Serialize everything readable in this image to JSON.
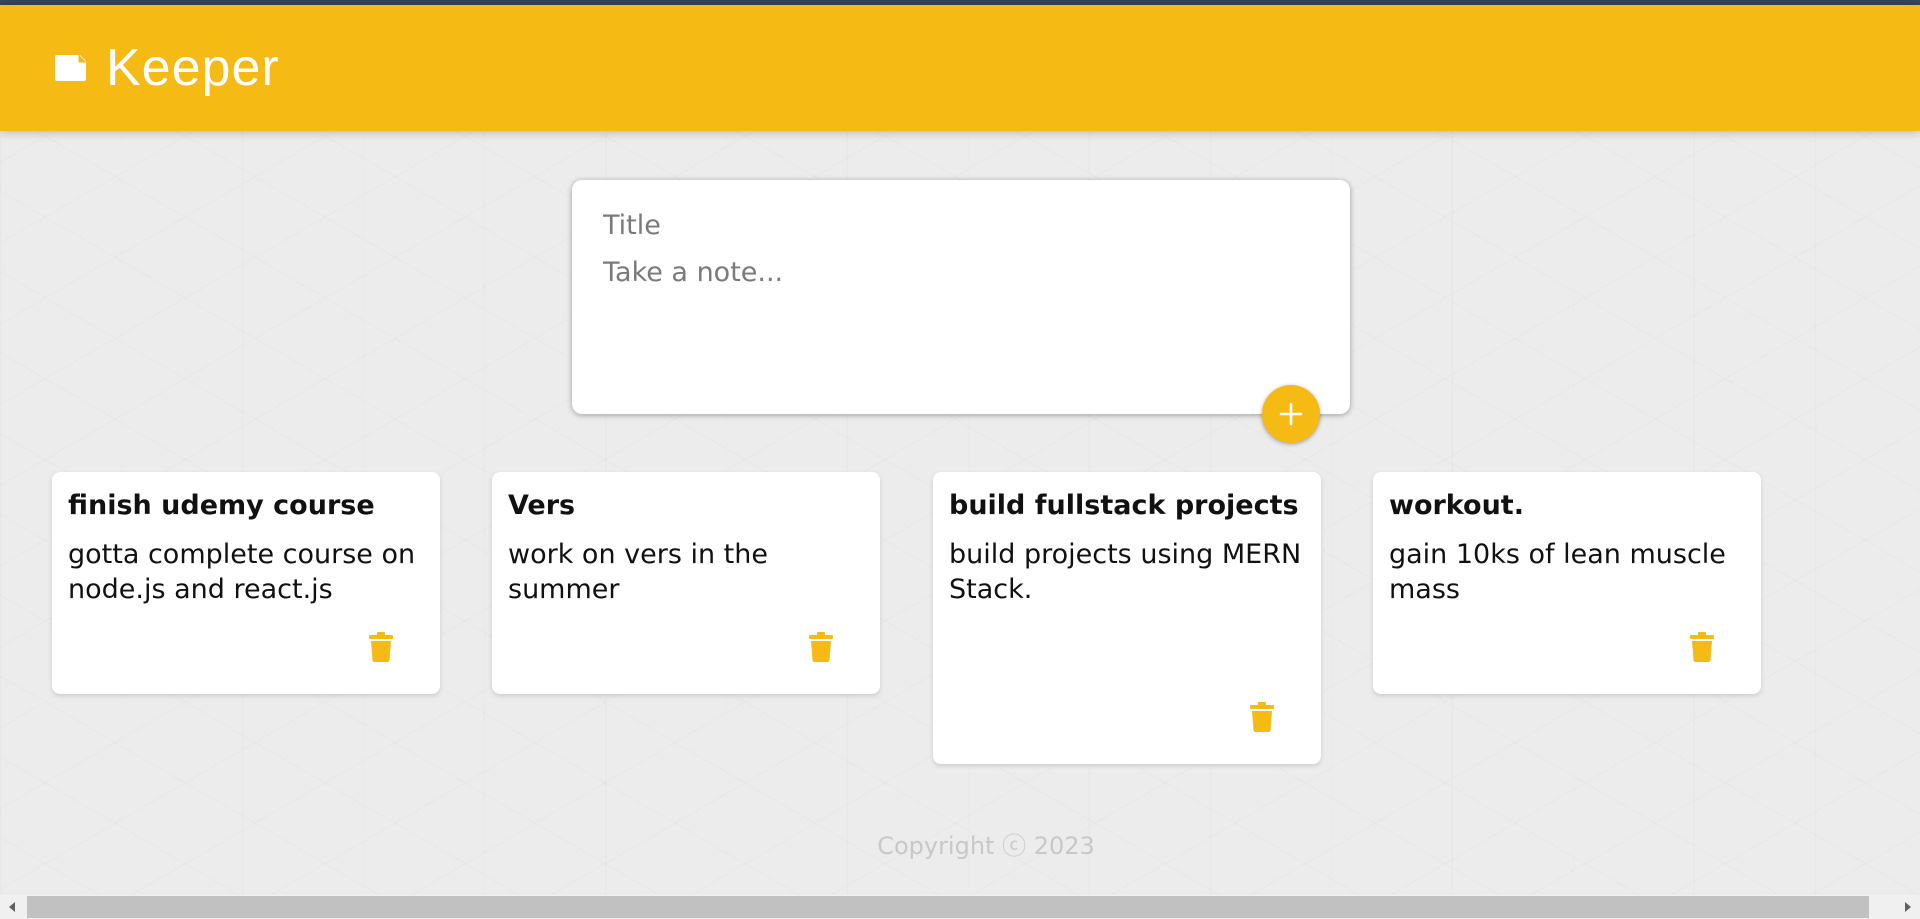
{
  "app": {
    "title": "Keeper",
    "logo_icon": "note-icon"
  },
  "colors": {
    "accent": "#f5ba13",
    "topline": "#3b4660",
    "background": "#ececec"
  },
  "composer": {
    "title_placeholder": "Title",
    "content_placeholder": "Take a note...",
    "add_button_icon": "plus-icon"
  },
  "notes": [
    {
      "title": "finish udemy course",
      "content": "gotta complete course on node.js and react.js",
      "delete_icon": "trash-icon"
    },
    {
      "title": "Vers",
      "content": "work on vers in the summer",
      "delete_icon": "trash-icon"
    },
    {
      "title": "build fullstack projects",
      "content": "build projects using MERN Stack.",
      "delete_icon": "trash-icon"
    },
    {
      "title": "workout.",
      "content": "gain 10ks of lean muscle mass",
      "delete_icon": "trash-icon"
    }
  ],
  "footer": {
    "text": "Copyright ⓒ 2023"
  }
}
